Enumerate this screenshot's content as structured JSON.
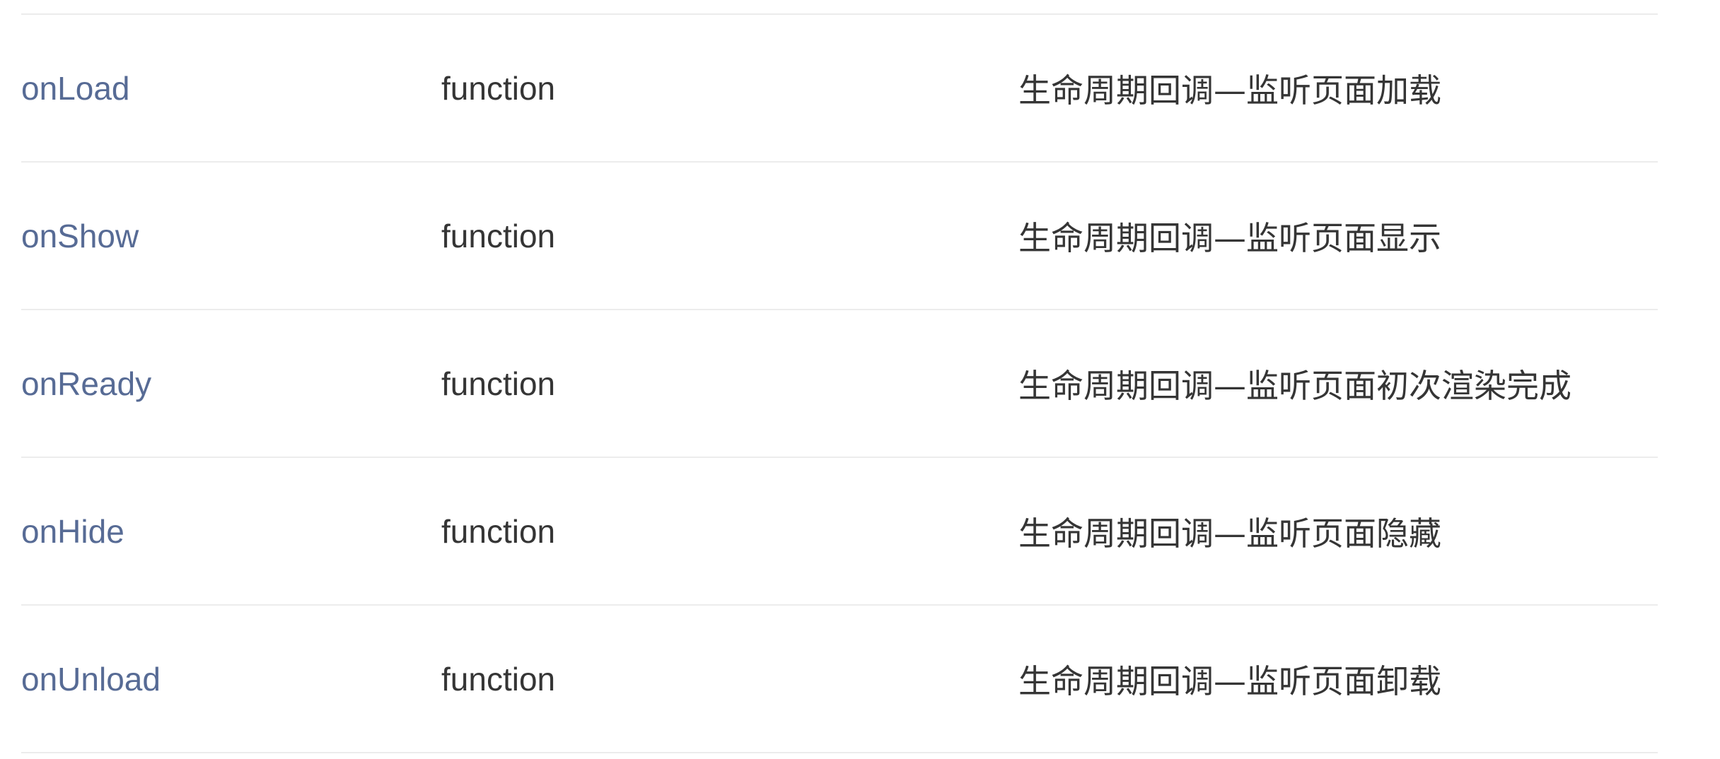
{
  "table": {
    "rows": [
      {
        "name": "onLoad",
        "type": "function",
        "description": "生命周期回调—监听页面加载"
      },
      {
        "name": "onShow",
        "type": "function",
        "description": "生命周期回调—监听页面显示"
      },
      {
        "name": "onReady",
        "type": "function",
        "description": "生命周期回调—监听页面初次渲染完成"
      },
      {
        "name": "onHide",
        "type": "function",
        "description": "生命周期回调—监听页面隐藏"
      },
      {
        "name": "onUnload",
        "type": "function",
        "description": "生命周期回调—监听页面卸载"
      }
    ]
  },
  "colors": {
    "link": "#576b95",
    "text": "#353535",
    "rule": "#ececec"
  }
}
